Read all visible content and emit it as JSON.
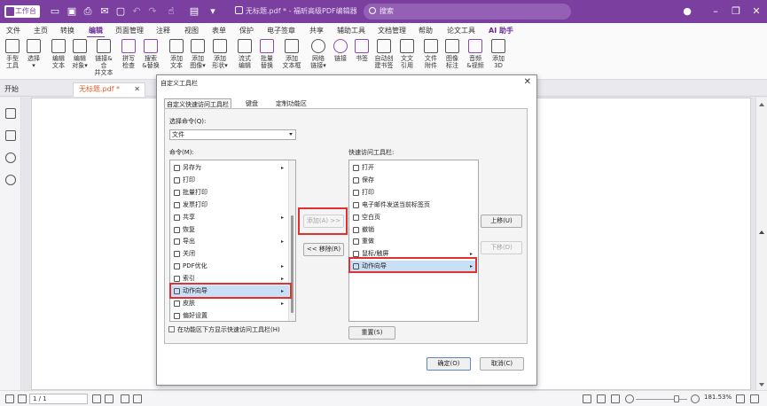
{
  "titlebar": {
    "logo_text": "工作台",
    "doc_title": "无标题.pdf * - 福昕高级PDF编辑器",
    "search_placeholder": "搜索"
  },
  "menu": [
    "文件",
    "主页",
    "转换",
    "编辑",
    "页面管理",
    "注释",
    "视图",
    "表单",
    "保护",
    "电子签章",
    "共享",
    "辅助工具",
    "文档管理",
    "帮助",
    "论文工具",
    "AI 助手"
  ],
  "menu_active": "编辑",
  "ribbon": [
    {
      "label": "手型\n工具",
      "icon": "hand-icon"
    },
    {
      "label": "选择\n▾",
      "icon": "select-icon"
    },
    {
      "label": "编辑\n文本",
      "icon": "edit-text-icon"
    },
    {
      "label": "编辑\n对象▾",
      "icon": "edit-object-icon"
    },
    {
      "label": "链接&合\n并文本",
      "icon": "link-merge-icon"
    },
    {
      "label": "拼写\n检查",
      "icon": "spellcheck-icon"
    },
    {
      "label": "搜索\n&替换",
      "icon": "search-replace-icon"
    },
    {
      "label": "添加\n文本",
      "icon": "add-text-icon"
    },
    {
      "label": "添加\n图像▾",
      "icon": "add-image-icon"
    },
    {
      "label": "添加\n形状▾",
      "icon": "add-shape-icon"
    },
    {
      "label": "流式\n编辑",
      "icon": "flow-edit-icon"
    },
    {
      "label": "批量\n替换",
      "icon": "batch-replace-icon"
    },
    {
      "label": "添加\n文本框",
      "icon": "add-textbox-icon"
    },
    {
      "label": "网络\n链接▾",
      "icon": "web-link-icon"
    },
    {
      "label": "链接",
      "icon": "link-icon"
    },
    {
      "label": "书签",
      "icon": "bookmark-icon"
    },
    {
      "label": "自动创\n建书签",
      "icon": "auto-bookmark-icon"
    },
    {
      "label": "文文\n引用",
      "icon": "reference-icon"
    },
    {
      "label": "文件\n附件",
      "icon": "attachment-icon"
    },
    {
      "label": "图像\n标注",
      "icon": "image-annotation-icon"
    },
    {
      "label": "音频\n&视频",
      "icon": "audio-video-icon"
    },
    {
      "label": "添加\n3D",
      "icon": "add-3d-icon"
    }
  ],
  "tabs": {
    "start": "开始",
    "doc": "无标题.pdf *"
  },
  "statusbar": {
    "page": "1 / 1",
    "zoom": "181.53%"
  },
  "dialog": {
    "title": "自定义工具栏",
    "tabs": [
      "自定义快速访问工具栏",
      "键盘",
      "定制功能区"
    ],
    "choose_label": "选择命令(Q):",
    "choose_value": "文件",
    "commands_label": "命令(M):",
    "commands": [
      {
        "label": "另存为",
        "sub": "▸"
      },
      {
        "label": "打印",
        "sub": ""
      },
      {
        "label": "批量打印",
        "sub": ""
      },
      {
        "label": "发票打印",
        "sub": ""
      },
      {
        "label": "共享",
        "sub": "▸"
      },
      {
        "label": "恢复",
        "sub": ""
      },
      {
        "label": "导出",
        "sub": "▸"
      },
      {
        "label": "关闭",
        "sub": ""
      },
      {
        "label": "PDF优化",
        "sub": "▸"
      },
      {
        "label": "索引",
        "sub": "▸"
      },
      {
        "label": "动作向导",
        "sub": "▸"
      },
      {
        "label": "皮肤",
        "sub": "▸"
      },
      {
        "label": "偏好设置",
        "sub": ""
      }
    ],
    "qa_label": "快速访问工具栏:",
    "quick_access": [
      {
        "label": "打开",
        "sub": ""
      },
      {
        "label": "保存",
        "sub": ""
      },
      {
        "label": "打印",
        "sub": ""
      },
      {
        "label": "电子邮件发送当前标签页",
        "sub": ""
      },
      {
        "label": "空白页",
        "sub": ""
      },
      {
        "label": "撤销",
        "sub": ""
      },
      {
        "label": "重做",
        "sub": ""
      },
      {
        "label": "鼠标/触屏",
        "sub": "▸"
      },
      {
        "label": "动作向导",
        "sub": "▸"
      }
    ],
    "add_button": "添加(A) >>",
    "remove_button": "<< 移除(R)",
    "up_button": "上移(U)",
    "down_button": "下移(D)",
    "reset_button": "重置(S)",
    "checkbox_label": "在功能区下方显示快速访问工具栏(H)",
    "ok_button": "确定(O)",
    "cancel_button": "取消(C)"
  }
}
